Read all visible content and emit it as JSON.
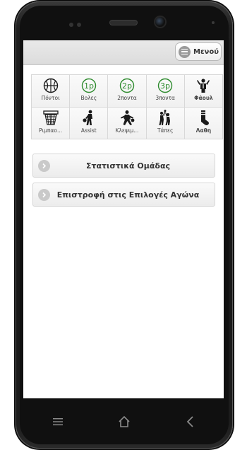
{
  "app_bar": {
    "menu_label": "Μενού"
  },
  "actions": [
    {
      "label": "Πόντοι",
      "icon": "basketball-icon"
    },
    {
      "label": "Βολες",
      "icon": "free-throw-1p-icon"
    },
    {
      "label": "2ποντα",
      "icon": "two-pointer-2p-icon"
    },
    {
      "label": "3ποντα",
      "icon": "three-pointer-3p-icon"
    },
    {
      "label": "Φάουλ",
      "icon": "foul-icon"
    },
    {
      "label": "Ριμπαο...",
      "icon": "rebound-hoop-icon"
    },
    {
      "label": "Assist",
      "icon": "assist-player-icon"
    },
    {
      "label": "Κλεψιμ...",
      "icon": "steal-player-icon"
    },
    {
      "label": "Τάπες",
      "icon": "block-players-icon"
    },
    {
      "label": "Λαθη",
      "icon": "turnover-sock-icon"
    }
  ],
  "menu": {
    "team_stats": "Στατιστικά Ομάδας",
    "back_to_options": "Επιστροφή στις Επιλογές Αγώνα"
  },
  "colors": {
    "green_accent": "#2e8b2e",
    "icon_dark": "#1a1a1a"
  }
}
